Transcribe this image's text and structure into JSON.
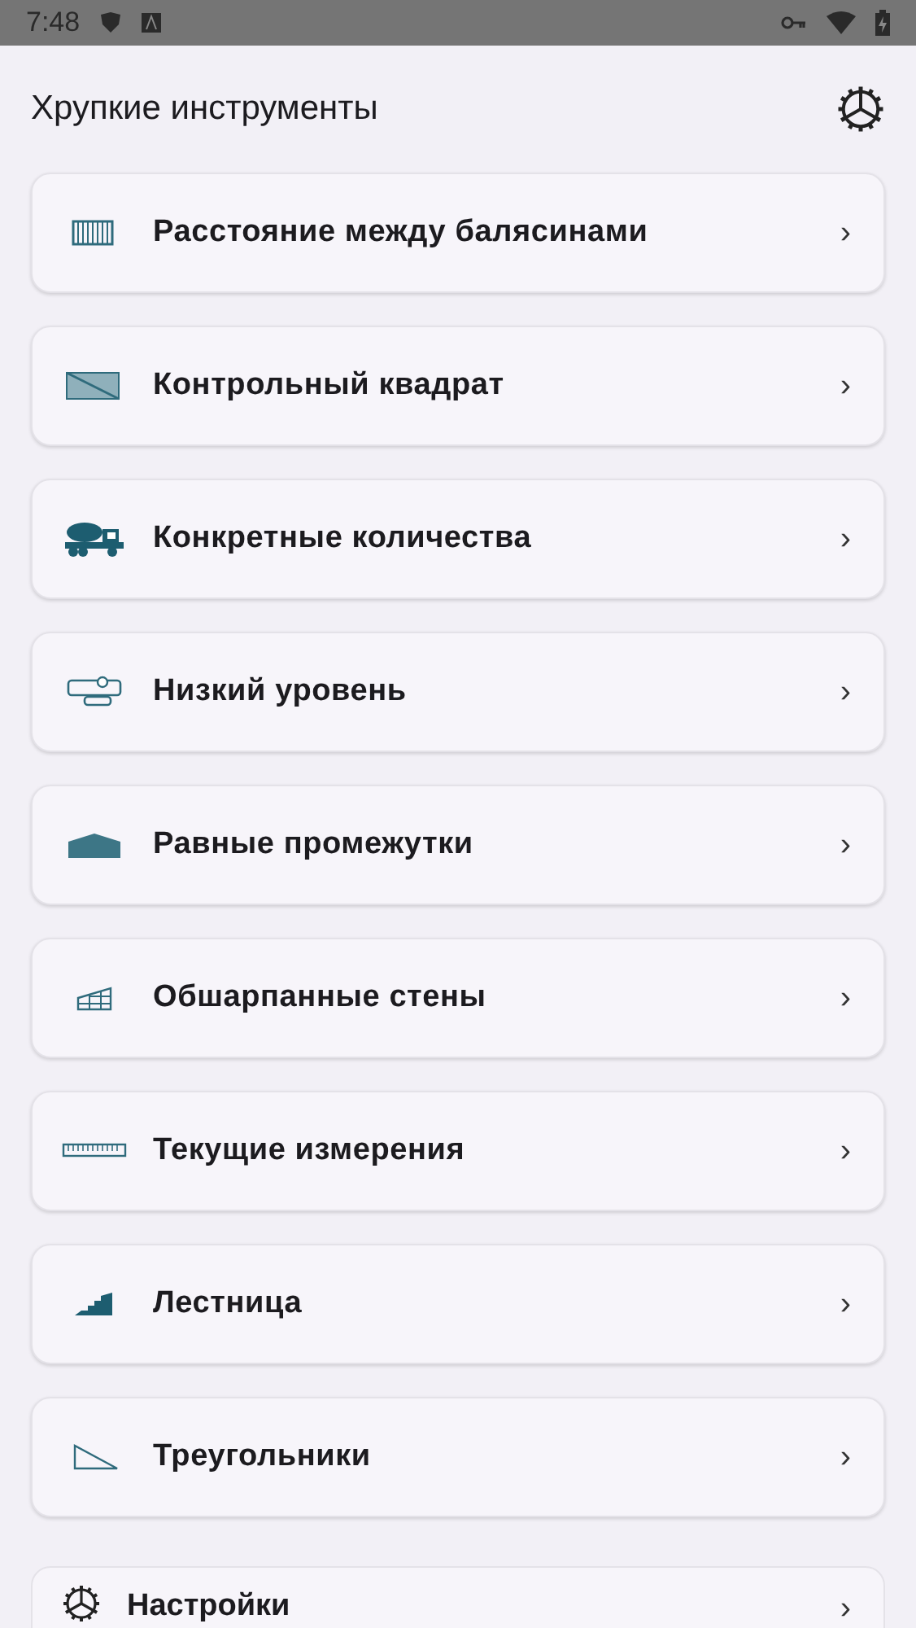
{
  "status_bar": {
    "time": "7:48"
  },
  "header": {
    "title": "Хрупкие инструменты"
  },
  "tools": [
    {
      "kind": "balusters",
      "label": "Расстояние между балясинами"
    },
    {
      "kind": "square",
      "label": "Контрольный квадрат"
    },
    {
      "kind": "mixer",
      "label": "Конкретные количества"
    },
    {
      "kind": "level",
      "label": "Низкий уровень"
    },
    {
      "kind": "roof",
      "label": "Равные промежутки"
    },
    {
      "kind": "wall",
      "label": "Обшарпанные стены"
    },
    {
      "kind": "ruler",
      "label": "Текущие измерения"
    },
    {
      "kind": "stairs",
      "label": "Лестница"
    },
    {
      "kind": "triangle",
      "label": "Треугольники"
    }
  ],
  "settings_item": {
    "label": "Настройки"
  },
  "chevron": "›"
}
